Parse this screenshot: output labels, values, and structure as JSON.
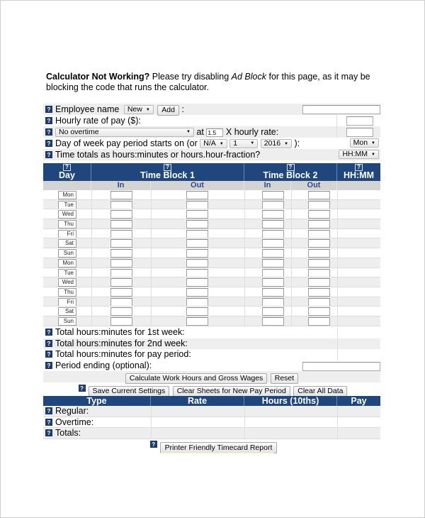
{
  "notice": {
    "bold": "Calculator Not Working?",
    "before_italic": " Please try disabling ",
    "italic": "Ad Block",
    "after_italic": " for this page, as it may be blocking the code that runs the calculator."
  },
  "help_glyph": "?",
  "settings": {
    "employee_label": "Employee name",
    "employee_select": "New",
    "add_button": "Add",
    "employee_colon": ":",
    "employee_value": "",
    "hourly_label": "Hourly rate of pay ($):",
    "hourly_value": "",
    "overtime_select": "No overtime",
    "at_label": "at",
    "multiplier_value": "1.5",
    "x_hourly_label": "X hourly rate:",
    "overtime_rate_value": "",
    "start_day_label": "Day of week pay period starts on (or",
    "start_month_select": "N/A",
    "start_day_select": "1",
    "start_year_select": "2016",
    "start_close": "):",
    "weekday_select": "Mon",
    "time_format_label": "Time totals as hours:minutes or hours.hour-fraction?",
    "time_format_select": "HH:MM"
  },
  "timesheet": {
    "headers": {
      "day": "Day",
      "block1": "Time Block 1",
      "block2": "Time Block 2",
      "total": "HH:MM",
      "in": "In",
      "out": "Out"
    },
    "days": [
      "Mon",
      "Tue",
      "Wed",
      "Thu",
      "Fri",
      "Sat",
      "Sun",
      "Mon",
      "Tue",
      "Wed",
      "Thu",
      "Fri",
      "Sat",
      "Sun"
    ]
  },
  "totals": {
    "week1": "Total hours:minutes for 1st week:",
    "week2": "Total hours:minutes for 2nd week:",
    "period": "Total hours:minutes for pay period:",
    "period_ending": "Period ending (optional):",
    "period_ending_value": ""
  },
  "buttons": {
    "calculate": "Calculate Work Hours and Gross Wages",
    "reset": "Reset",
    "save_settings": "Save Current Settings",
    "clear_sheets": "Clear Sheets for New Pay Period",
    "clear_all": "Clear All Data",
    "printer": "Printer Friendly Timecard Report"
  },
  "pay_table": {
    "headers": [
      "Type",
      "Rate",
      "Hours (10ths)",
      "Pay"
    ],
    "rows": [
      "Regular:",
      "Overtime:",
      "Totals:"
    ]
  },
  "colors": {
    "header_blue": "#1f477e",
    "row_alt": "#eeeeee",
    "subheader_gray": "#d4d4d4",
    "subheader_text": "#2c4e86"
  }
}
